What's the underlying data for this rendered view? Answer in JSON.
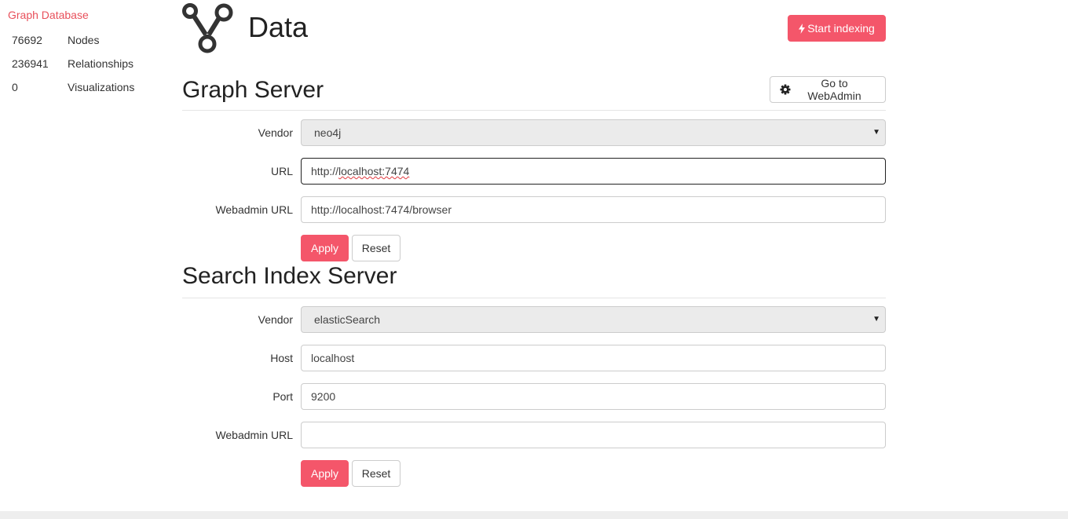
{
  "sidebar": {
    "title": "Graph Database",
    "stats": [
      {
        "value": "76692",
        "label": "Nodes"
      },
      {
        "value": "236941",
        "label": "Relationships"
      },
      {
        "value": "0",
        "label": "Visualizations"
      }
    ]
  },
  "header": {
    "logo_icon": "graph-nodes-icon",
    "title": "Data",
    "start_indexing_label": "Start indexing",
    "start_indexing_icon": "lightning-bolt-icon"
  },
  "graph_server": {
    "title": "Graph Server",
    "webadmin_button_label": "Go to WebAdmin",
    "webadmin_button_icon": "gear-icon",
    "vendor_label": "Vendor",
    "vendor_value": "neo4j",
    "url_label": "URL",
    "url_prefix": "http://",
    "url_misspelled": "localhost:7474",
    "webadmin_url_label": "Webadmin URL",
    "webadmin_url_value": "http://localhost:7474/browser",
    "apply_label": "Apply",
    "reset_label": "Reset"
  },
  "search_index_server": {
    "title": "Search Index Server",
    "vendor_label": "Vendor",
    "vendor_value": "elasticSearch",
    "host_label": "Host",
    "host_value": "localhost",
    "port_label": "Port",
    "port_value": "9200",
    "webadmin_url_label": "Webadmin URL",
    "webadmin_url_value": "",
    "apply_label": "Apply",
    "reset_label": "Reset"
  },
  "colors": {
    "accent": "#f4566a",
    "sidebar_title": "#e8505b",
    "select_bg": "#ebebeb"
  }
}
